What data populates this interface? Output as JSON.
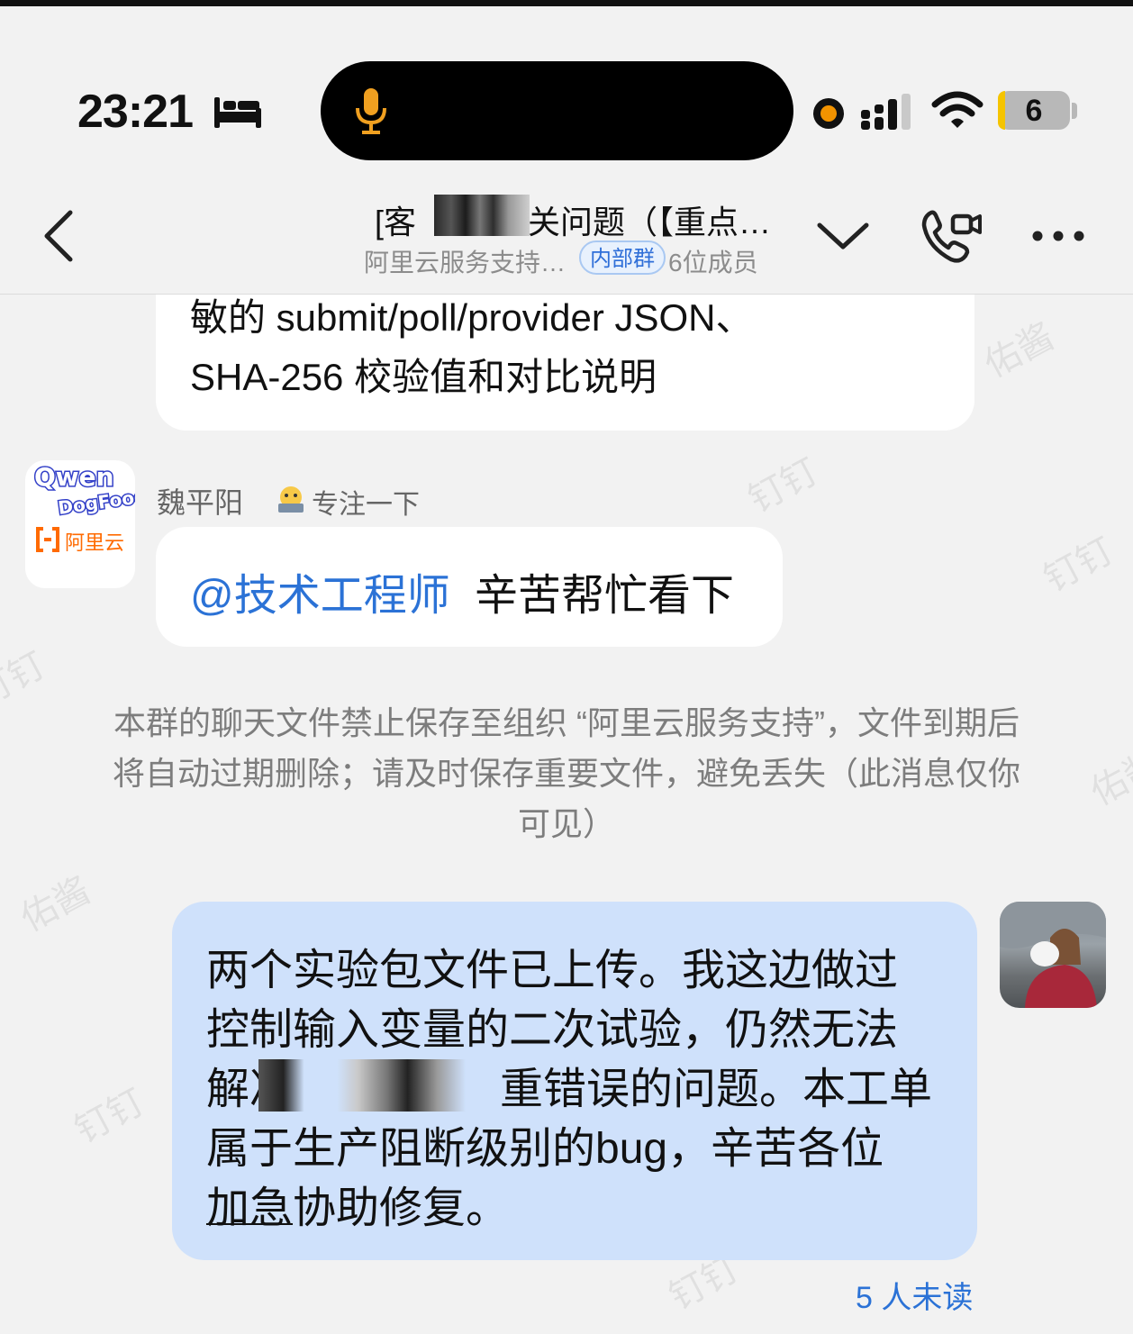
{
  "status_bar": {
    "time": "23:21",
    "battery": "6",
    "icons": [
      "bed-icon",
      "mic-icon",
      "recording-dot",
      "signal-icon",
      "wifi-icon",
      "battery-icon"
    ]
  },
  "header": {
    "title_prefix": "[客",
    "title_suffix": "关问题（【重点…",
    "subtitle": "阿里云服务支持…",
    "badge": "内部群",
    "members": "6位成员"
  },
  "messages": {
    "partial_bubble_lines": [
      "敏的 submit/poll/provider JSON、",
      "SHA-256 校验值和对比说明"
    ],
    "sender_name": "魏平阳",
    "sender_status": "专注一下",
    "mention": "@技术工程师",
    "mention_text": "辛苦帮忙看下",
    "system_notice": "本群的聊天文件禁止保存至组织 “阿里云服务支持”，文件到期后将自动过期删除；请及时保存重要文件，避免丢失（此消息仅你可见）",
    "my_message": {
      "line1": "两个实验包文件已上传。我这边做过",
      "line2": "控制输入变量的二次试验，仍然无法",
      "line3_a": "解决",
      "line3_b": "重错误的问题。本工单",
      "line4": "属于生产阻断级别的bug，辛苦各位",
      "line5_a": "加急",
      "line5_b": "协助修复。"
    },
    "unread": "5 人未读"
  },
  "watermarks": [
    "钉钉",
    "佑酱"
  ],
  "colors": {
    "mention": "#2b72d6",
    "my_bubble": "#cfe1fb",
    "badge": "#2f6fd8"
  }
}
